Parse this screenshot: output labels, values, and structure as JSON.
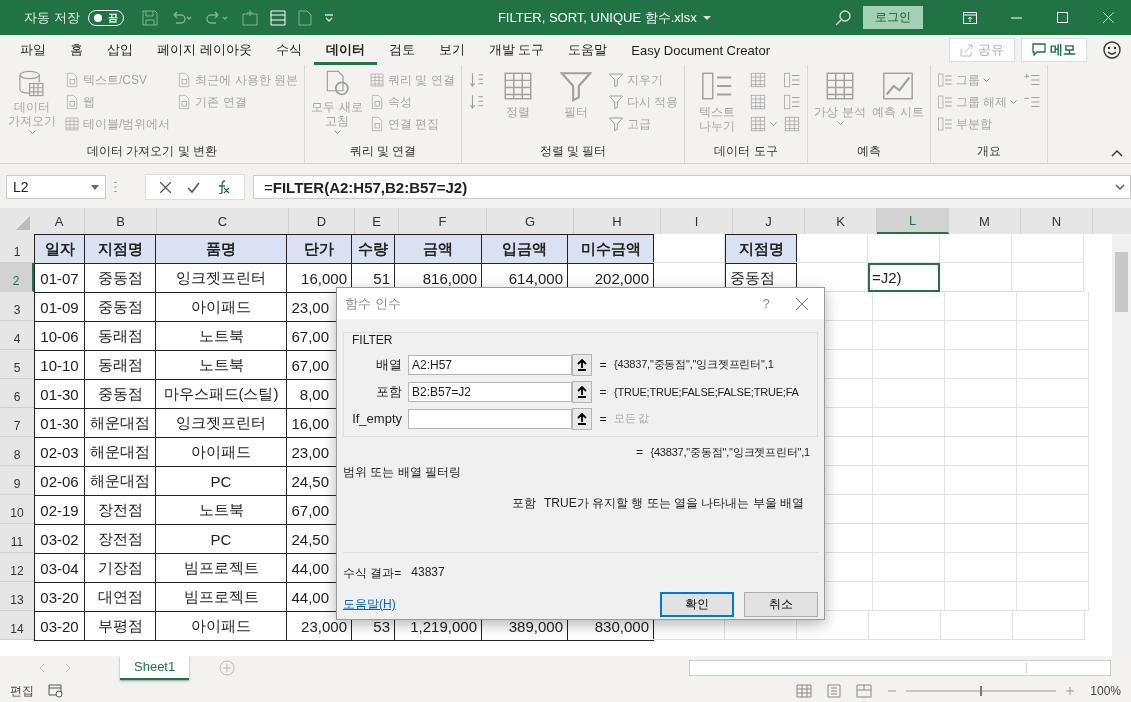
{
  "titlebar": {
    "autosave_label": "자동 저장",
    "autosave": {
      "on": false,
      "label": "끔"
    },
    "title": "FILTER, SORT, UNIQUE 함수.xlsx",
    "login": "로그인"
  },
  "tabs": [
    {
      "label": "파일",
      "selected": false
    },
    {
      "label": "홈",
      "selected": false
    },
    {
      "label": "삽입",
      "selected": false
    },
    {
      "label": "페이지 레이아웃",
      "selected": false
    },
    {
      "label": "수식",
      "selected": false
    },
    {
      "label": "데이터",
      "selected": true
    },
    {
      "label": "검토",
      "selected": false
    },
    {
      "label": "보기",
      "selected": false
    },
    {
      "label": "개발 도구",
      "selected": false
    },
    {
      "label": "도움말",
      "selected": false
    },
    {
      "label": "Easy Document Creator",
      "selected": false
    }
  ],
  "share": {
    "label": "공유",
    "disabled": true
  },
  "memo": {
    "label": "메모",
    "disabled": false
  },
  "ribbon": [
    {
      "label": "데이터 가져오기 및 변환",
      "items": [
        {
          "kind": "large",
          "label": "데이터 가져오기",
          "dropdown": true,
          "disabled": true
        },
        {
          "kind": "small",
          "label": "텍스트/CSV",
          "dropdown": false,
          "disabled": true
        },
        {
          "kind": "small",
          "label": "웹",
          "dropdown": false,
          "disabled": true
        },
        {
          "kind": "small",
          "label": "테이블/범위에서",
          "dropdown": false,
          "disabled": true
        },
        {
          "kind": "small",
          "label": "최근에 사용한 원본",
          "dropdown": false,
          "disabled": true
        },
        {
          "kind": "small",
          "label": "기존 연결",
          "dropdown": false,
          "disabled": true
        }
      ]
    },
    {
      "label": "쿼리 및 연결",
      "items": [
        {
          "kind": "large",
          "label": "모두 새로 고침",
          "dropdown": true,
          "disabled": true
        },
        {
          "kind": "small",
          "label": "쿼리 및 연결",
          "dropdown": false,
          "disabled": true
        },
        {
          "kind": "small",
          "label": "속성",
          "dropdown": false,
          "disabled": true
        },
        {
          "kind": "small",
          "label": "연결 편집",
          "dropdown": false,
          "disabled": true
        }
      ]
    },
    {
      "label": "정렬 및 필터",
      "items": [
        {
          "kind": "icon",
          "dropdown": false,
          "disabled": true
        },
        {
          "kind": "icon",
          "dropdown": false,
          "disabled": true
        },
        {
          "kind": "large",
          "label": "정렬",
          "dropdown": false,
          "disabled": true
        },
        {
          "kind": "large",
          "label": "필터",
          "dropdown": false,
          "disabled": true
        },
        {
          "kind": "small",
          "label": "지우기",
          "dropdown": false,
          "disabled": true
        },
        {
          "kind": "small",
          "label": "다시 적용",
          "dropdown": false,
          "disabled": true
        },
        {
          "kind": "small",
          "label": "고급",
          "dropdown": false,
          "disabled": true
        }
      ]
    },
    {
      "label": "데이터 도구",
      "items": [
        {
          "kind": "large",
          "label": "텍스트 나누기",
          "dropdown": false,
          "disabled": true
        },
        {
          "kind": "icon",
          "dropdown": false,
          "disabled": true
        },
        {
          "kind": "icon",
          "dropdown": false,
          "disabled": true
        },
        {
          "kind": "icon",
          "dropdown": true,
          "disabled": true
        },
        {
          "kind": "icon",
          "dropdown": false,
          "disabled": true
        },
        {
          "kind": "icon",
          "dropdown": false,
          "disabled": true
        },
        {
          "kind": "icon",
          "dropdown": false,
          "disabled": true
        }
      ]
    },
    {
      "label": "예측",
      "items": [
        {
          "kind": "large",
          "label": "가상 분석",
          "dropdown": true,
          "disabled": true
        },
        {
          "kind": "large",
          "label": "예측 시트",
          "dropdown": false,
          "disabled": true
        }
      ]
    },
    {
      "label": "개요",
      "items": [
        {
          "kind": "small",
          "label": "그룹",
          "dropdown": true,
          "disabled": true
        },
        {
          "kind": "small",
          "label": "그룹 해제",
          "dropdown": true,
          "disabled": true
        },
        {
          "kind": "small",
          "label": "부분합",
          "dropdown": false,
          "disabled": true
        },
        {
          "kind": "icon",
          "dropdown": false,
          "disabled": true
        },
        {
          "kind": "icon",
          "dropdown": false,
          "disabled": true
        }
      ]
    }
  ],
  "formula_bar": {
    "name_box": "L2",
    "formula": "=**FILTER(A2:H57,B2:B57=J2)**"
  },
  "columns": [
    {
      "label": "A",
      "selected": false
    },
    {
      "label": "B",
      "selected": false
    },
    {
      "label": "C",
      "selected": false
    },
    {
      "label": "D",
      "selected": false
    },
    {
      "label": "E",
      "selected": false
    },
    {
      "label": "F",
      "selected": false
    },
    {
      "label": "G",
      "selected": false
    },
    {
      "label": "H",
      "selected": false
    },
    {
      "label": "I",
      "selected": false
    },
    {
      "label": "J",
      "selected": false
    },
    {
      "label": "K",
      "selected": false
    },
    {
      "label": "L",
      "selected": true
    },
    {
      "label": "M",
      "selected": false
    },
    {
      "label": "N",
      "selected": false
    }
  ],
  "rows": [
    {
      "label": "1",
      "kind": "header",
      "selected": false,
      "cells": [
        "일자",
        "지점명",
        "품명",
        "단가",
        "수량",
        "금액",
        "입금액",
        "미수금액",
        null,
        "지점명"
      ]
    },
    {
      "label": "2",
      "kind": "data",
      "selected": true,
      "cells": [
        "01-07",
        "중동점",
        "잉크젯프린터",
        "16,000",
        "51",
        "816,000",
        "614,000",
        "202,000",
        null,
        "중동점",
        null,
        "=J2)"
      ]
    },
    {
      "label": "3",
      "kind": "covered",
      "selected": false,
      "cells": [
        "01-09",
        "중동점",
        "아이패드",
        "23,00"
      ]
    },
    {
      "label": "4",
      "kind": "covered",
      "selected": false,
      "cells": [
        "10-06",
        "동래점",
        "노트북",
        "67,00"
      ]
    },
    {
      "label": "5",
      "kind": "covered",
      "selected": false,
      "cells": [
        "10-10",
        "동래점",
        "노트북",
        "67,00"
      ]
    },
    {
      "label": "6",
      "kind": "covered",
      "selected": false,
      "cells": [
        "01-30",
        "중동점",
        "마우스패드(스틸)",
        "8,00"
      ]
    },
    {
      "label": "7",
      "kind": "covered",
      "selected": false,
      "cells": [
        "01-30",
        "해운대점",
        "잉크젯프린터",
        "16,00"
      ]
    },
    {
      "label": "8",
      "kind": "covered",
      "selected": false,
      "cells": [
        "02-03",
        "해운대점",
        "아이패드",
        "23,00"
      ]
    },
    {
      "label": "9",
      "kind": "covered",
      "selected": false,
      "cells": [
        "02-06",
        "해운대점",
        "PC",
        "24,50"
      ]
    },
    {
      "label": "10",
      "kind": "covered",
      "selected": false,
      "cells": [
        "02-19",
        "장전점",
        "노트북",
        "67,00"
      ]
    },
    {
      "label": "11",
      "kind": "covered",
      "selected": false,
      "cells": [
        "03-02",
        "장전점",
        "PC",
        "24,50"
      ]
    },
    {
      "label": "12",
      "kind": "covered",
      "selected": false,
      "cells": [
        "03-04",
        "기장점",
        "빔프로젝트",
        "44,00"
      ]
    },
    {
      "label": "13",
      "kind": "covered",
      "selected": false,
      "cells": [
        "03-20",
        "대연점",
        "빔프로젝트",
        "44,00"
      ]
    },
    {
      "label": "14",
      "kind": "data",
      "selected": false,
      "cells": [
        "03-20",
        "부평점",
        "아이패드",
        "23,000",
        "53",
        "1,219,000",
        "389,000",
        "830,000"
      ]
    }
  ],
  "dialog": {
    "title": "함수 인수",
    "help": "?",
    "function": "FILTER",
    "args": [
      {
        "label": "배열",
        "value": "A2:H57",
        "equals": "=",
        "evaluation": "{43837,\"중동점\",\"잉크젯프린터\",1",
        "muted": false
      },
      {
        "label": "포함",
        "value": "B2:B57=J2",
        "equals": "=",
        "evaluation": "{TRUE;TRUE;FALSE;FALSE;TRUE;FA",
        "muted": false
      },
      {
        "label": "If_empty",
        "equals": "=",
        "evaluation": "모든 값",
        "muted": true
      }
    ],
    "result_equals": "=",
    "result": "{43837,\"중동점\",\"잉크젯프린터\",1",
    "description": "범위 또는 배열 필터링",
    "arg_name": "포함",
    "arg_help": "TRUE가 유지할 행 또는 열을 나타내는 부울 배열",
    "formula_result_label": "수식 결과=",
    "formula_result": "43837",
    "help_link": "도움말(H)",
    "buttons": [
      {
        "label": "확인",
        "default": true
      },
      {
        "label": "취소",
        "default": false
      }
    ]
  },
  "sheets": [
    {
      "label": "Sheet1",
      "selected": true
    }
  ],
  "status": {
    "mode": "편집",
    "zoom_slider": {
      "level": 0.5
    },
    "zoom": "100%"
  }
}
